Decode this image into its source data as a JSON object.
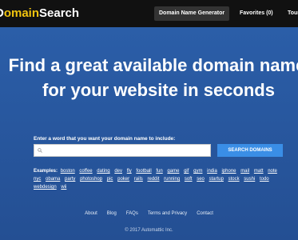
{
  "brand": {
    "prefix": "D",
    "accent": "omain",
    "rest": "Search"
  },
  "nav": {
    "generator_label": "Domain Name Generator",
    "favorites_label": "Favorites (0)",
    "tour_label": "Tour"
  },
  "hero": {
    "headline_line1": "Find a great available domain name",
    "headline_line2": "for your website in seconds",
    "prompt": "Enter a word that you want your domain name to include:",
    "search_value": "",
    "search_placeholder": "",
    "search_button": "SEARCH DOMAINS"
  },
  "examples": {
    "label": "Examples:",
    "words": [
      "boston",
      "coffee",
      "dating",
      "dev",
      "fly",
      "football",
      "fun",
      "game",
      "gif",
      "gym",
      "india",
      "iphone",
      "mail",
      "matt",
      "note",
      "nyc",
      "obama",
      "party",
      "photoshop",
      "pic",
      "poker",
      "rails",
      "reddit",
      "running",
      "soft",
      "seo",
      "startup",
      "stock",
      "sushi",
      "todo",
      "webdesign",
      "wii"
    ]
  },
  "footer": {
    "links": [
      "About",
      "Blog",
      "FAQs",
      "Terms and Privacy",
      "Contact"
    ],
    "copyright": "© 2017 Automattic Inc."
  },
  "colors": {
    "topbar": "#111111",
    "hero_bg": "#2a5aa3",
    "button": "#3a8ee6",
    "logo_accent": "#f1c40f"
  },
  "icons": {
    "search": "search-icon"
  }
}
